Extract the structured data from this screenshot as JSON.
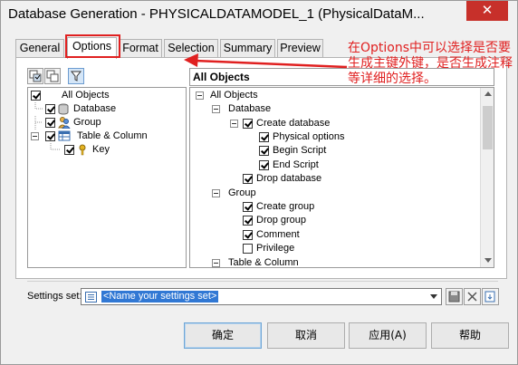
{
  "window": {
    "title": "Database Generation - PHYSICALDATAMODEL_1 (PhysicalDataM...",
    "close_glyph": "✕"
  },
  "tabs": [
    {
      "label": "General",
      "active": false
    },
    {
      "label": "Options",
      "active": true
    },
    {
      "label": "Format",
      "active": false
    },
    {
      "label": "Selection",
      "active": false
    },
    {
      "label": "Summary",
      "active": false
    },
    {
      "label": "Preview",
      "active": false
    }
  ],
  "annotation": {
    "text": "在Options中可以选择是否要生成主键外键，是否生成注释等详细的选择。",
    "color": "#e02020"
  },
  "left_tree": {
    "items": [
      {
        "label": "All Objects",
        "checked": true,
        "icon": "none"
      },
      {
        "label": "Database",
        "checked": true,
        "icon": "database-icon"
      },
      {
        "label": "Group",
        "checked": true,
        "icon": "group-icon"
      },
      {
        "label": "Table & Column",
        "checked": true,
        "icon": "table-icon"
      },
      {
        "label": "Key",
        "checked": true,
        "icon": "key-icon"
      }
    ]
  },
  "right_panel": {
    "header": "All Objects",
    "items": [
      {
        "label": "All Objects",
        "type": "expander"
      },
      {
        "label": "Database",
        "type": "expander"
      },
      {
        "label": "Create database",
        "type": "expander-check",
        "checked": true
      },
      {
        "label": "Physical options",
        "type": "check",
        "checked": true
      },
      {
        "label": "Begin Script",
        "type": "check",
        "checked": true
      },
      {
        "label": "End Script",
        "type": "check",
        "checked": true
      },
      {
        "label": "Drop database",
        "type": "check",
        "checked": true
      },
      {
        "label": "Group",
        "type": "expander"
      },
      {
        "label": "Create group",
        "type": "check",
        "checked": true
      },
      {
        "label": "Drop group",
        "type": "check",
        "checked": true
      },
      {
        "label": "Comment",
        "type": "check",
        "checked": true
      },
      {
        "label": "Privilege",
        "type": "check",
        "checked": false
      },
      {
        "label": "Table & Column",
        "type": "expander"
      }
    ]
  },
  "settings": {
    "label": "Settings set:",
    "value": "<Name your settings set>"
  },
  "buttons": {
    "ok": "确定",
    "cancel": "取消",
    "apply": "应用(A)",
    "help": "帮助"
  }
}
